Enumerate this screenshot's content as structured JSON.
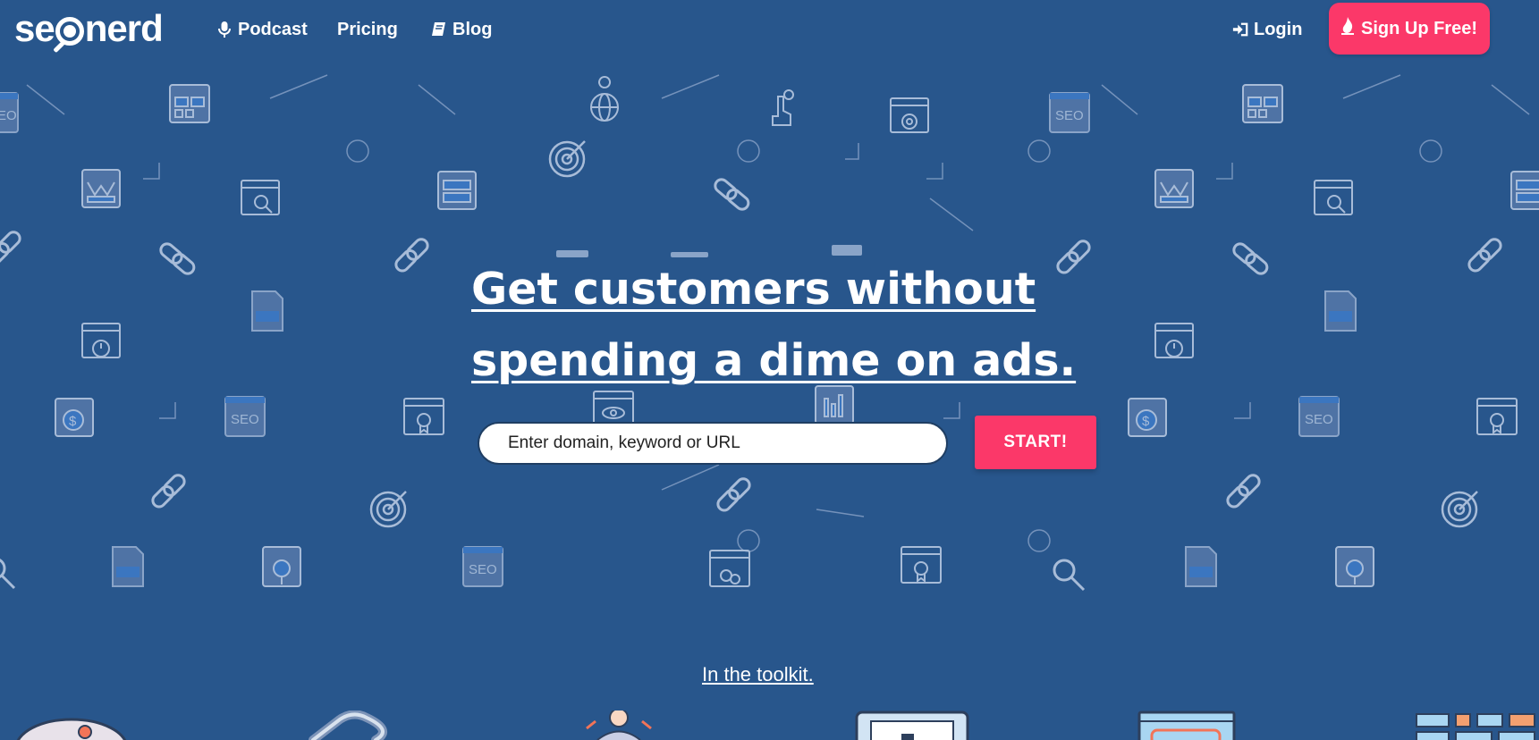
{
  "brand": {
    "name_part1": "se",
    "name_part2": "nerd"
  },
  "nav": {
    "podcast": "Podcast",
    "pricing": "Pricing",
    "blog": "Blog",
    "login": "Login",
    "signup": "Sign Up Free!"
  },
  "hero": {
    "title_line1": "Get customers without",
    "title_line2": "spending a dime on ads."
  },
  "search": {
    "placeholder": "Enter domain, keyword or URL",
    "button": "START!"
  },
  "toolkit": {
    "link": "In the toolkit."
  },
  "colors": {
    "background": "#28568c",
    "accent": "#fb3869",
    "pattern": "#9fb6d4"
  }
}
